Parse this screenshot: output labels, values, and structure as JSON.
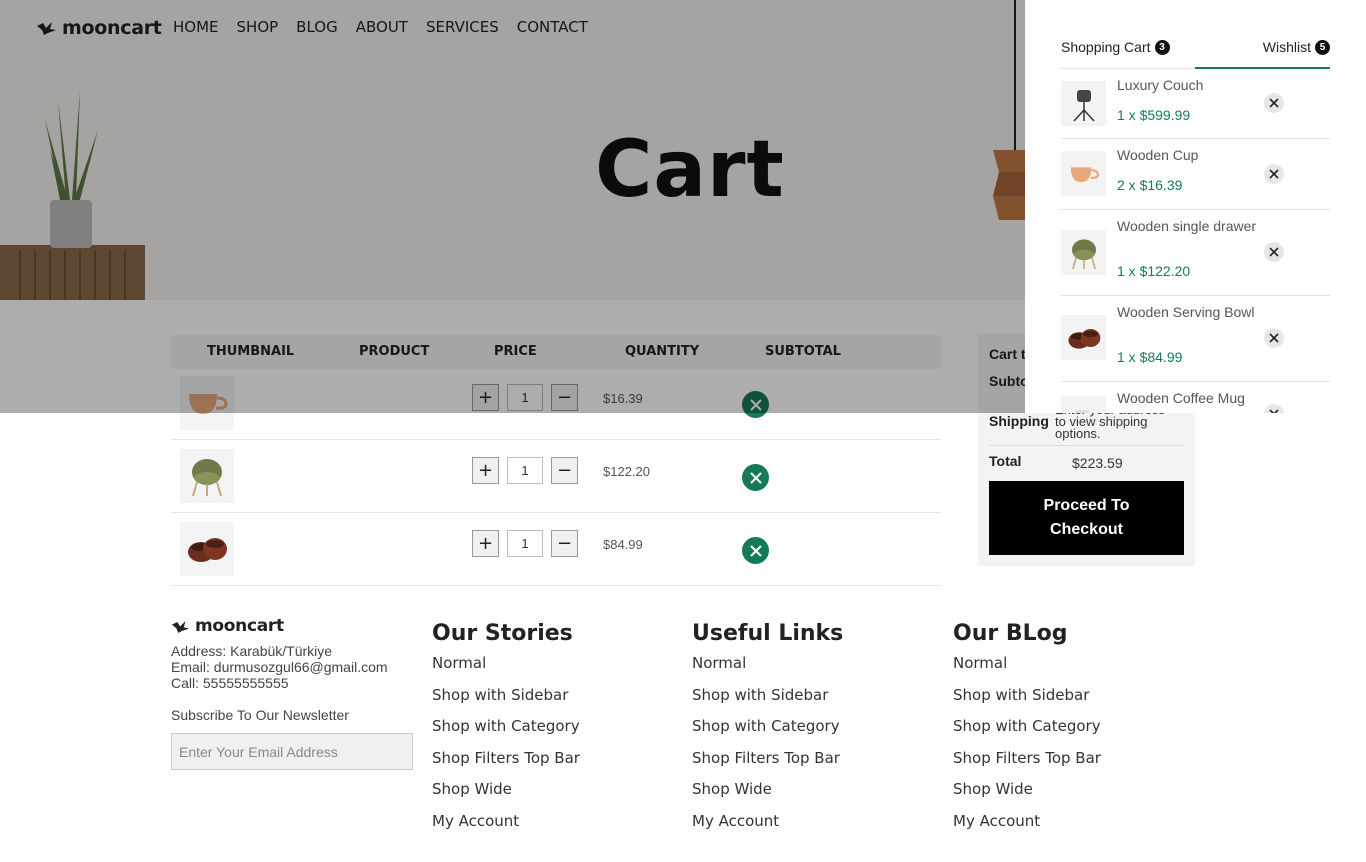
{
  "brand": "mooncart",
  "nav": [
    "HOME",
    "SHOP",
    "BLOG",
    "ABOUT",
    "SERVICES",
    "CONTACT"
  ],
  "hero": {
    "title": "Cart"
  },
  "table": {
    "headers": [
      "THUMBNAIL",
      "PRODUCT",
      "PRICE",
      "QUANTITY",
      "SUBTOTAL"
    ],
    "rows": [
      {
        "thumb_icon": "wooden-cup-icon",
        "qty": "1",
        "price": "$16.39"
      },
      {
        "thumb_icon": "chair-icon",
        "qty": "1",
        "price": "$122.20"
      },
      {
        "thumb_icon": "bowl-icon",
        "qty": "1",
        "price": "$84.99"
      }
    ]
  },
  "totals": {
    "title": "Cart to",
    "subtotal_label": "Subto",
    "shipping_label": "Shipping",
    "shipping_value_line1": "Enter your address",
    "shipping_value_line2": "to view shipping",
    "shipping_value_line3": "options.",
    "total_label": "Total",
    "total_value": "$223.59",
    "checkout_line1": "Proceed To",
    "checkout_line2": "Checkout"
  },
  "panel": {
    "cart_tab": "Shopping Cart",
    "cart_count": "3",
    "wishlist_tab": "Wishlist",
    "wishlist_count": "5",
    "items": [
      {
        "name": "Luxury Couch",
        "meta": "1 x $599.99",
        "icon": "lamp-icon"
      },
      {
        "name": "Wooden Cup",
        "meta": "2 x $16.39",
        "icon": "wooden-cup-icon"
      },
      {
        "name": "Wooden single drawer",
        "meta": "1 x $122.20",
        "icon": "chair-icon"
      },
      {
        "name": "Wooden Serving Bowl",
        "meta": "1 x $84.99",
        "icon": "bowl-icon"
      },
      {
        "name": "Wooden Coffee Mug",
        "meta": "",
        "icon": "mug-icon"
      }
    ]
  },
  "footer": {
    "address": "Address: Karabük/Türkiye",
    "email": "Email: durmusozgul66@gmail.com",
    "call": "Call: 55555555555",
    "newsletter_label": "Subscribe To Our Newsletter",
    "newsletter_placeholder": "Enter Your Email Address",
    "columns": [
      {
        "title": "Our Stories",
        "links": [
          "Normal",
          "Shop with Sidebar",
          "Shop with Category",
          "Shop Filters Top Bar",
          "Shop Wide",
          "My Account"
        ]
      },
      {
        "title": "Useful Links",
        "links": [
          "Normal",
          "Shop with Sidebar",
          "Shop with Category",
          "Shop Filters Top Bar",
          "Shop Wide",
          "My Account"
        ]
      },
      {
        "title": "Our BLog",
        "links": [
          "Normal",
          "Shop with Sidebar",
          "Shop with Category",
          "Shop Filters Top Bar",
          "Shop Wide",
          "My Account"
        ]
      }
    ]
  },
  "colors": {
    "accent": "#157a5a",
    "overlay": "rgba(0,0,0,0.32)"
  }
}
